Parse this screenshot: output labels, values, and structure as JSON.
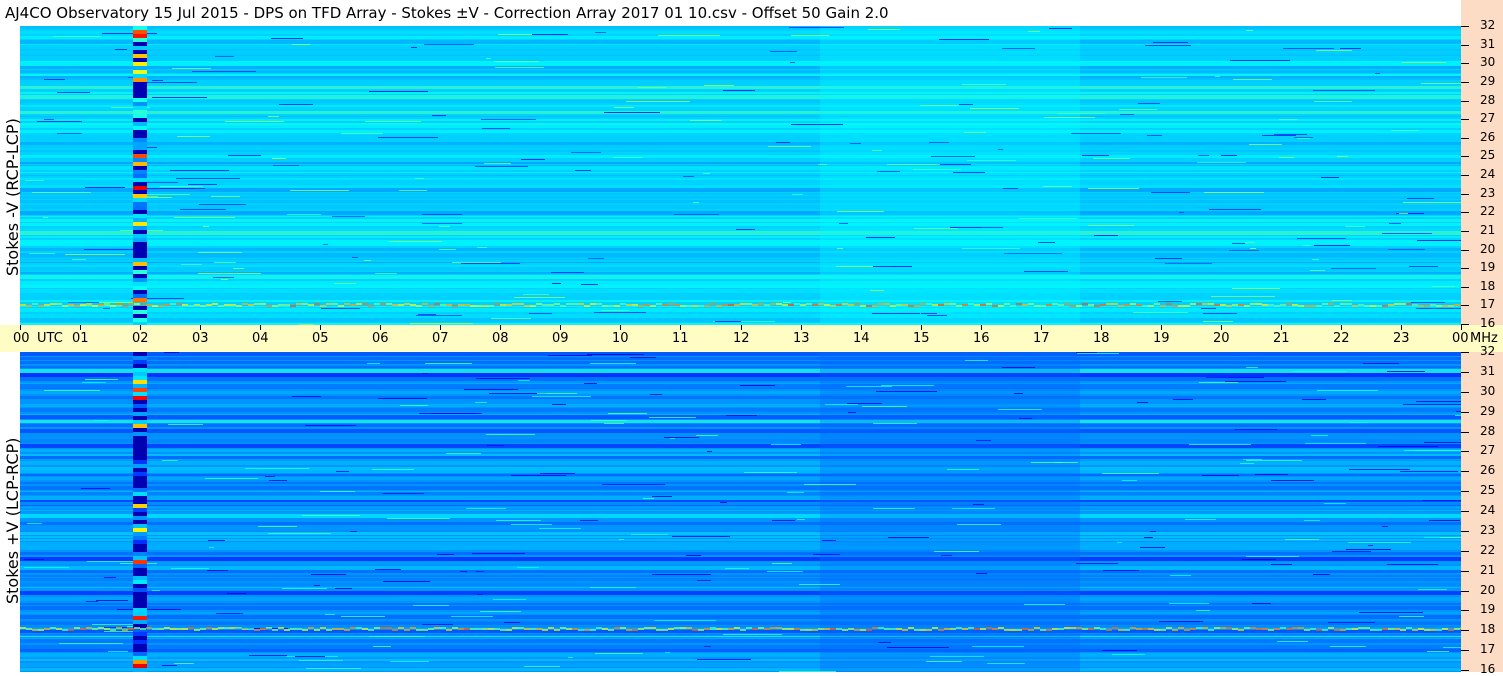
{
  "title": "AJ4CO Observatory  15 Jul 2015  -  DPS on TFD Array  -  Stokes ±V  -  Correction Array 2017 01 10.csv  -  Offset 50  Gain 2.0",
  "panels": [
    {
      "id": "top",
      "ylabel": "Stokes -V (RCP-LCP)"
    },
    {
      "id": "bottom",
      "ylabel": "Stokes +V (LCP-RCP)"
    }
  ],
  "x_axis": {
    "labels": [
      "00",
      "01",
      "02",
      "03",
      "04",
      "05",
      "06",
      "07",
      "08",
      "09",
      "10",
      "11",
      "12",
      "13",
      "14",
      "15",
      "16",
      "17",
      "18",
      "19",
      "20",
      "21",
      "22",
      "23",
      "00"
    ],
    "first_suffix": "UTC",
    "last_suffix": "MHz"
  },
  "freq_axis": {
    "labels": [
      "32",
      "31",
      "30",
      "29",
      "28",
      "27",
      "26",
      "25",
      "24",
      "23",
      "22",
      "21",
      "20",
      "19",
      "18",
      "17",
      "16"
    ]
  },
  "colors": {
    "background_field": "#1a78e0",
    "utc_strip": "#fffcc4",
    "freq_strip": "#fcdcc4"
  },
  "chart_data": [
    {
      "type": "heatmap",
      "title": "AJ4CO Observatory  15 Jul 2015  -  DPS on TFD Array  -  Stokes ±V  -  Correction Array 2017 01 10.csv  -  Offset 50  Gain 2.0",
      "xlabel": "UTC",
      "ylabel": "Stokes -V (RCP-LCP)",
      "x_range": [
        0,
        24
      ],
      "y_range": [
        16,
        32
      ],
      "y_unit": "MHz",
      "colormap": "jet",
      "grid": false
    },
    {
      "type": "heatmap",
      "title": "",
      "xlabel": "UTC",
      "ylabel": "Stokes +V (LCP-RCP)",
      "x_range": [
        0,
        24
      ],
      "y_range": [
        16,
        32
      ],
      "y_unit": "MHz",
      "colormap": "jet",
      "grid": false
    }
  ]
}
